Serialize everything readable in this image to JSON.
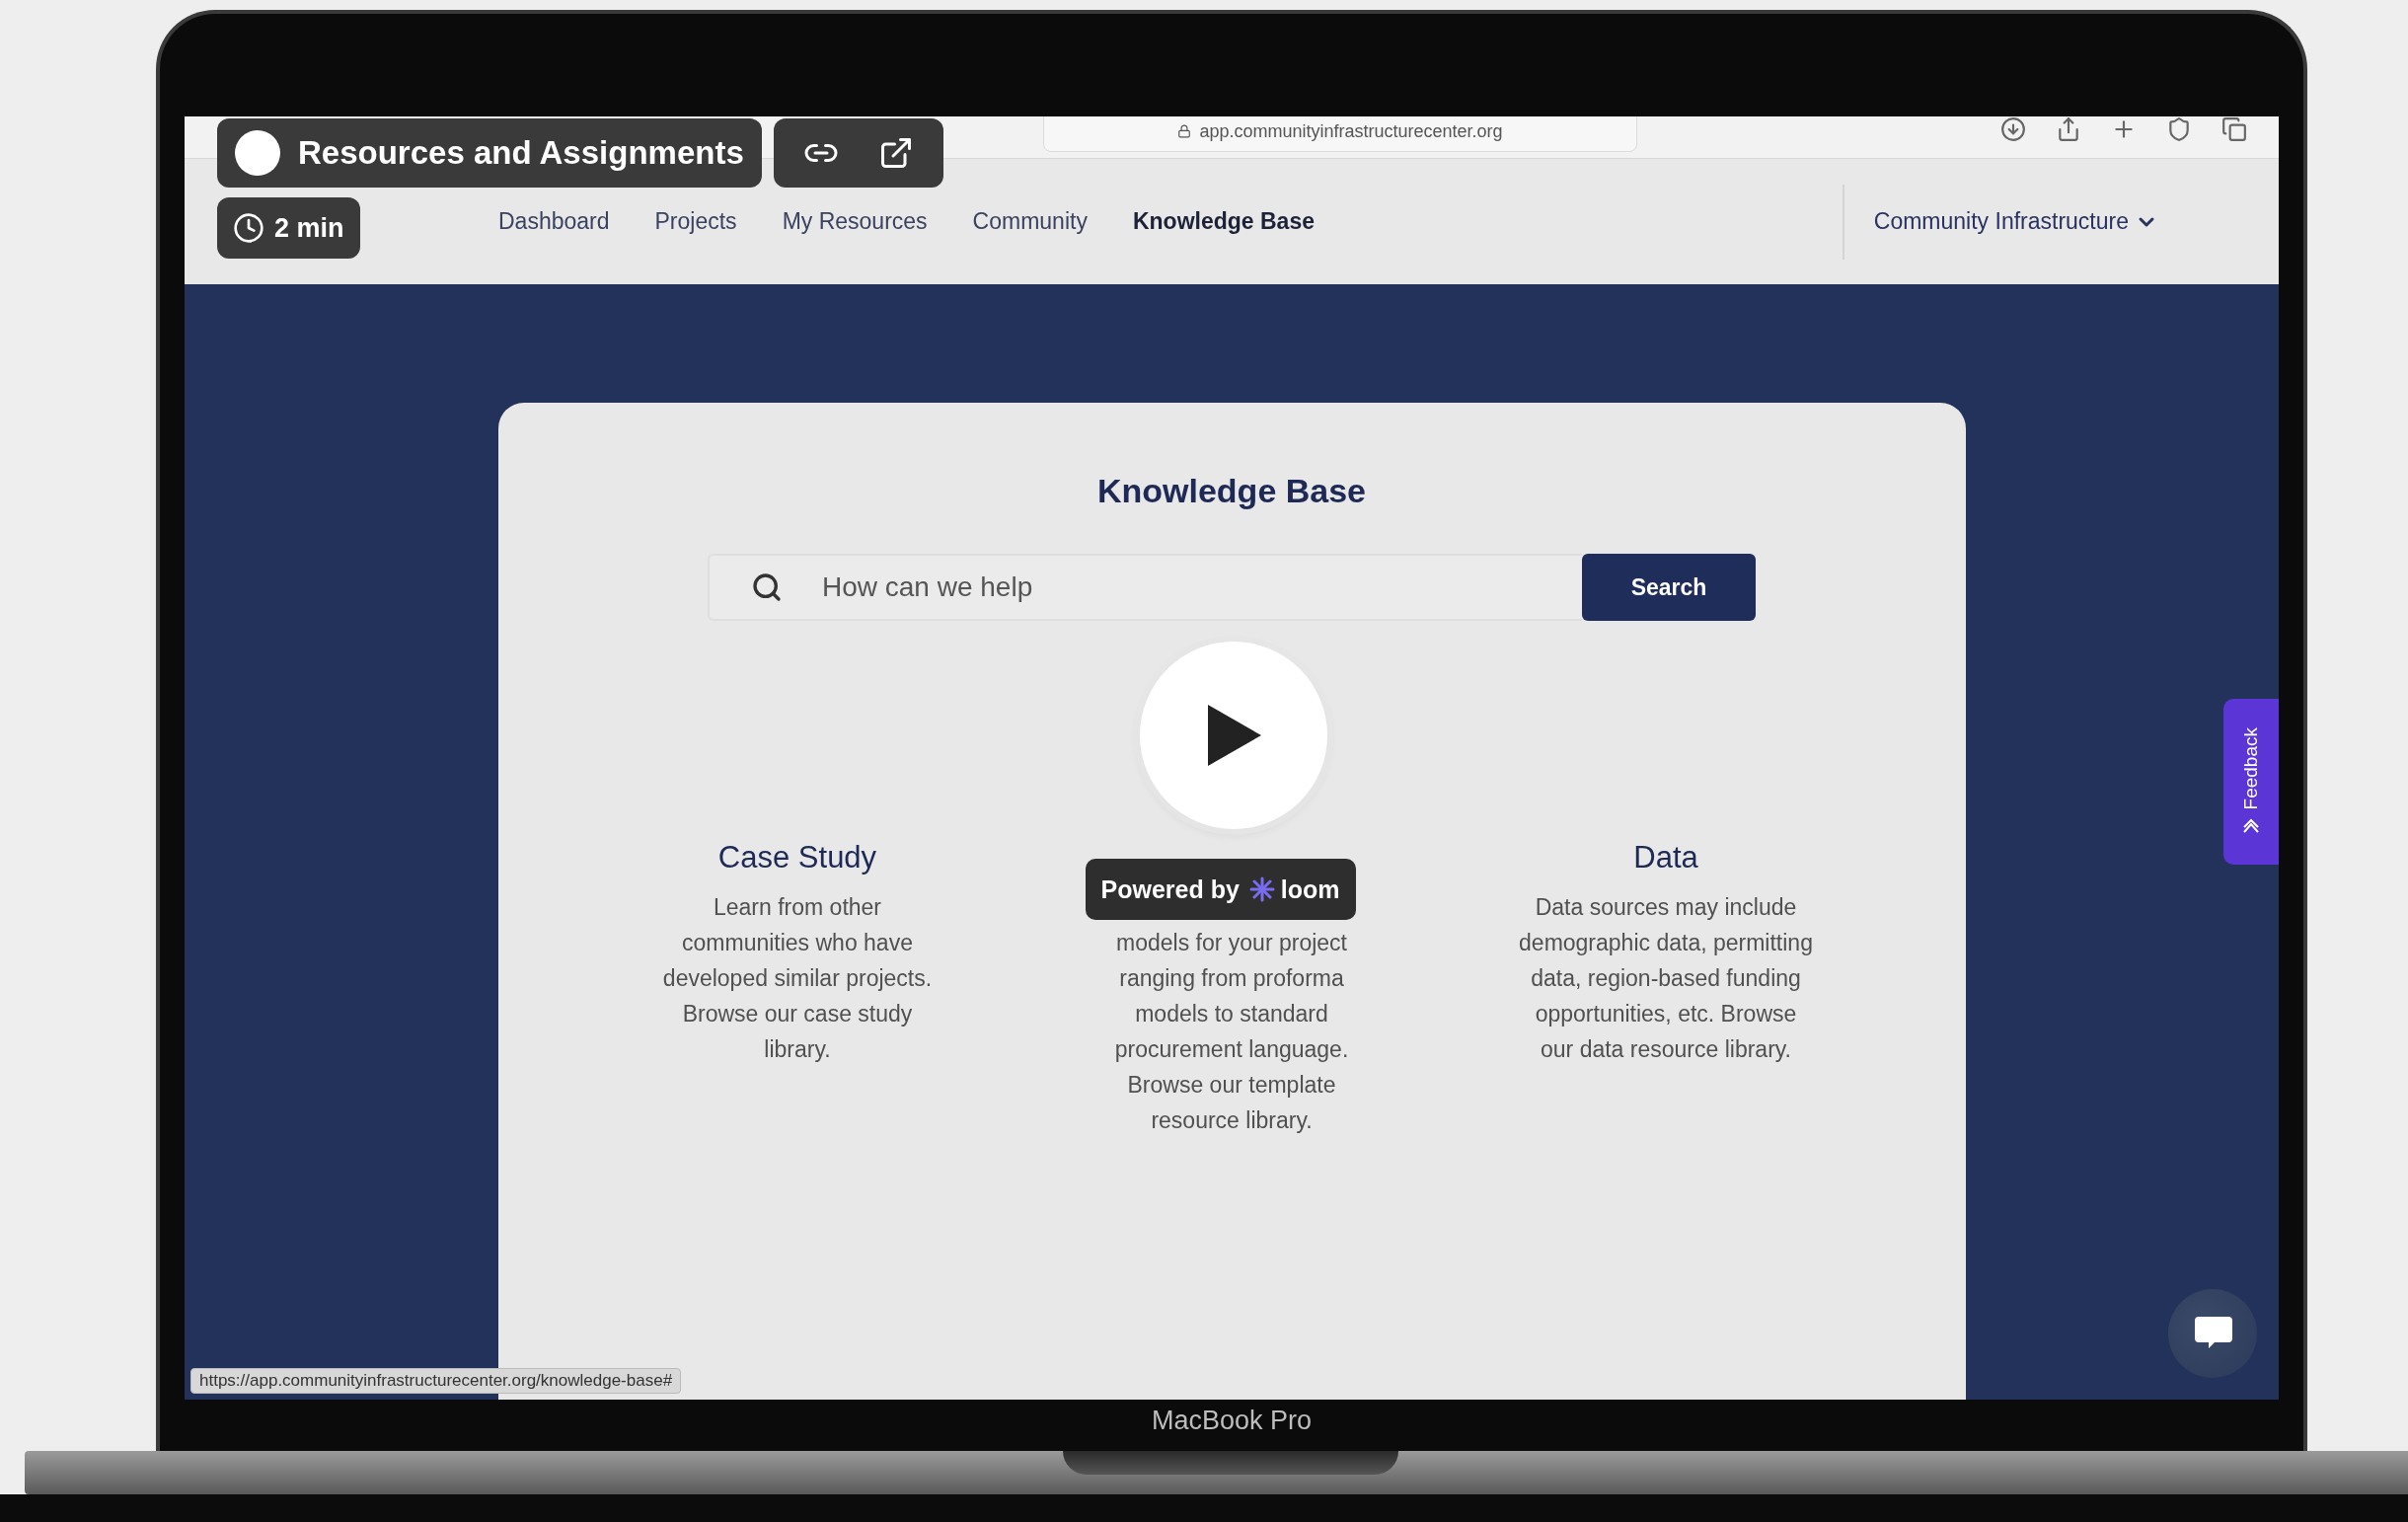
{
  "browser": {
    "address": "app.communityinfrastructurecenter.org",
    "status_url": "https://app.communityinfrastructurecenter.org/knowledge-base#"
  },
  "nav": {
    "items": [
      {
        "label": "Dashboard",
        "selected": false
      },
      {
        "label": "Projects",
        "selected": false
      },
      {
        "label": "My Resources",
        "selected": false
      },
      {
        "label": "Community",
        "selected": false
      },
      {
        "label": "Knowledge Base",
        "selected": true
      }
    ],
    "org_menu": "Community Infrastructure"
  },
  "knowledge_base": {
    "title": "Knowledge Base",
    "search": {
      "placeholder": "How can we help",
      "button": "Search"
    },
    "categories": [
      {
        "title": "Case Study",
        "description": "Learn from other communities who have developed similar projects. Browse our case study library."
      },
      {
        "description": "models for your project ranging from proforma models to standard procurement language. Browse our template resource library."
      },
      {
        "title": "Data",
        "description": "Data sources may include demographic data, permitting data, region-based funding opportunities, etc. Browse our data resource library."
      }
    ]
  },
  "feedback_tab": "Feedback",
  "video_overlay": {
    "title": "Resources and Assignments",
    "duration": "2 min",
    "badge_prefix": "Powered by",
    "badge_brand": "loom"
  },
  "device_label": "MacBook Pro"
}
